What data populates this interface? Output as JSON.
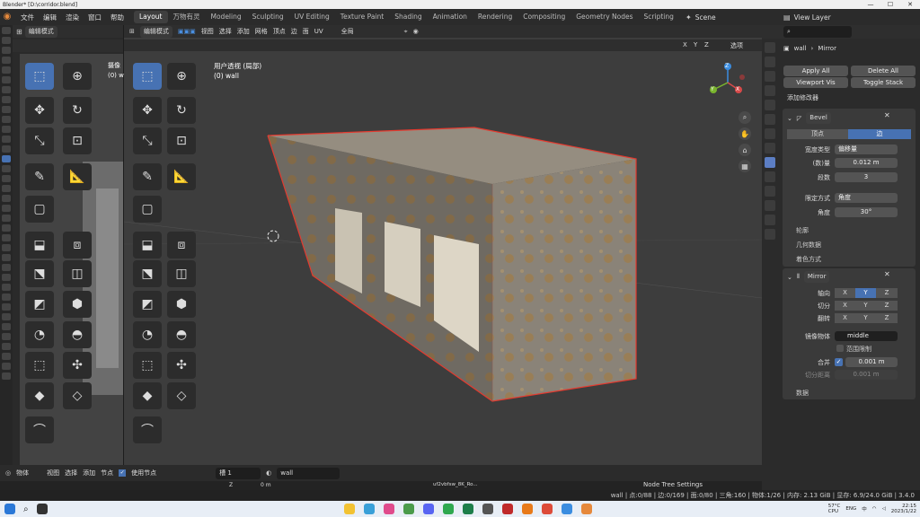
{
  "window": {
    "title": "Blender* [D:\\corridor.blend]"
  },
  "menu": [
    "文件",
    "编辑",
    "渲染",
    "窗口",
    "帮助"
  ],
  "workspaces": [
    "Layout",
    "万物有灵",
    "Modeling",
    "Sculpting",
    "UV Editing",
    "Texture Paint",
    "Shading",
    "Animation",
    "Rendering",
    "Compositing",
    "Geometry Nodes",
    "Scripting"
  ],
  "scene": {
    "name": "Scene"
  },
  "view_layer": {
    "name": "View Layer"
  },
  "left_header": {
    "mode": "编辑模式"
  },
  "left_info": {
    "label": "摄像",
    "obj": "(0) w"
  },
  "vp_header": {
    "mode": "编辑模式",
    "view": "视图",
    "select": "选择",
    "add": "添加",
    "mesh": "网格",
    "vertex": "顶点",
    "edge": "边",
    "face": "面",
    "uv": "UV",
    "transform": "全局",
    "options": "选项"
  },
  "viewport": {
    "view_name": "用户透视 (局部)",
    "object": "(0) wall",
    "axes": {
      "x": "X",
      "y": "Y",
      "z": "Z"
    },
    "sym": [
      "X",
      "Y",
      "Z"
    ]
  },
  "properties": {
    "search_placeholder": "",
    "object": "wall",
    "modifier_path": "Mirror",
    "apply_all": "Apply All",
    "delete_all": "Delete All",
    "viewport_vis": "Viewport Vis",
    "toggle_stack": "Toggle Stack",
    "add_modifier": "添加修改器",
    "bevel": {
      "name": "Bevel",
      "mode_vertex": "顶点",
      "mode_edge": "边",
      "width_type_label": "宽度类型",
      "width_type": "偏移量",
      "amount_label": "(数)量",
      "amount": "0.012 m",
      "segments_label": "段数",
      "segments": "3",
      "limit_label": "限定方式",
      "limit": "角度",
      "angle_label": "角度",
      "angle": "30°",
      "sub_profile": "轮廓",
      "sub_geometry": "几何数据",
      "sub_shading": "着色方式"
    },
    "mirror": {
      "name": "Mirror",
      "axis_label": "轴向",
      "bisect_label": "切分",
      "flip_label": "翻转",
      "axes": [
        "X",
        "Y",
        "Z"
      ],
      "mirror_obj_label": "镜像物体",
      "mirror_obj": "middle",
      "clip": "范围限制",
      "merge": "合并",
      "merge_val": "0.001 m",
      "bisect_dist_label": "切分距离",
      "bisect_dist": "0.001 m",
      "sub_data": "数据"
    }
  },
  "bottom": {
    "object": "物体",
    "view": "视图",
    "select": "选择",
    "add": "添加",
    "node": "节点",
    "use_nodes": "使用节点",
    "slot": "槽 1",
    "material": "wall",
    "node_tree": "Node Tree Settings",
    "tex": "uf2vbfsw_8K_Ro..."
  },
  "timeline": {
    "a": "Z",
    "b": "0 m"
  },
  "status": "wall | 点:0/88 | 边:0/169 | 面:0/80 | 三角:160 | 物体:1/26 | 内存: 2.13 GiB | 显存: 6.9/24.0 GiB | 3.4.0",
  "tray": {
    "input": "ENG",
    "lang": "中",
    "temp": "57°C",
    "cpu": "CPU",
    "time": "22:15",
    "date": "2023/1/22"
  },
  "colors": {
    "accent": "#4772b3",
    "select_edge": "#e43a2f"
  }
}
